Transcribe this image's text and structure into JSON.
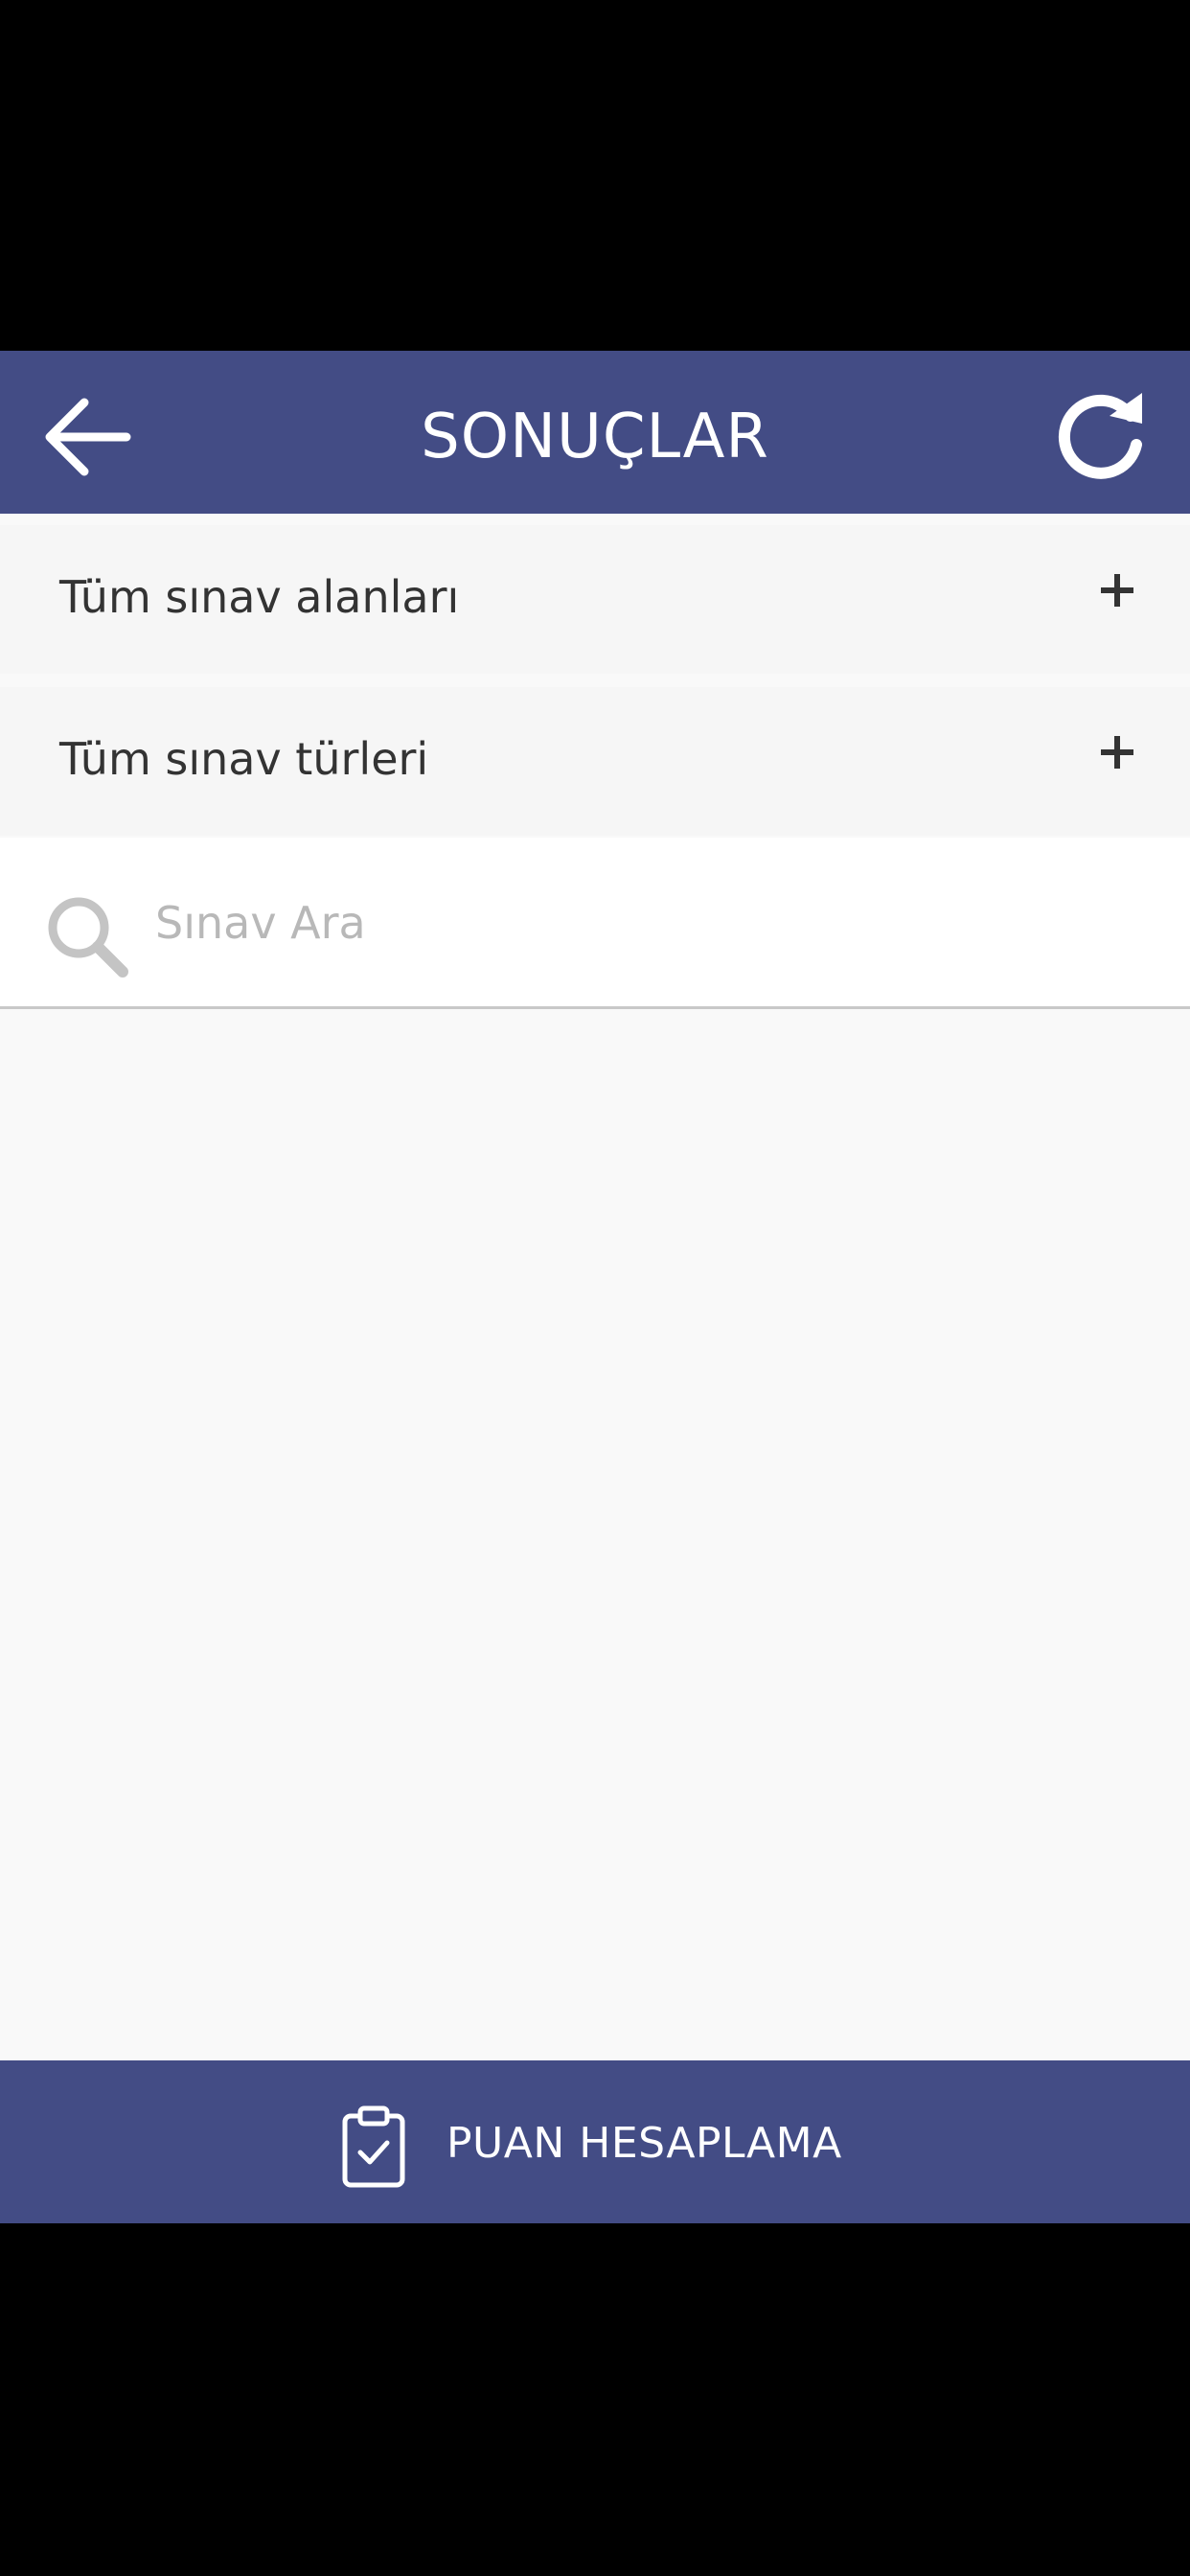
{
  "header": {
    "title": "SONUÇLAR",
    "back_icon": "arrow-left-icon",
    "refresh_icon": "refresh-icon"
  },
  "filters": [
    {
      "label": "Tüm sınav alanları",
      "icon": "plus-icon"
    },
    {
      "label": "Tüm sınav türleri",
      "icon": "plus-icon"
    }
  ],
  "search": {
    "placeholder": "Sınav Ara",
    "value": "",
    "icon": "search-icon"
  },
  "bottom_bar": {
    "label": "PUAN HESAPLAMA",
    "icon": "clipboard-check-icon"
  },
  "colors": {
    "primary": "#434c85",
    "background": "#f9f9f9",
    "text": "#333333",
    "placeholder": "#b8b8b8"
  }
}
